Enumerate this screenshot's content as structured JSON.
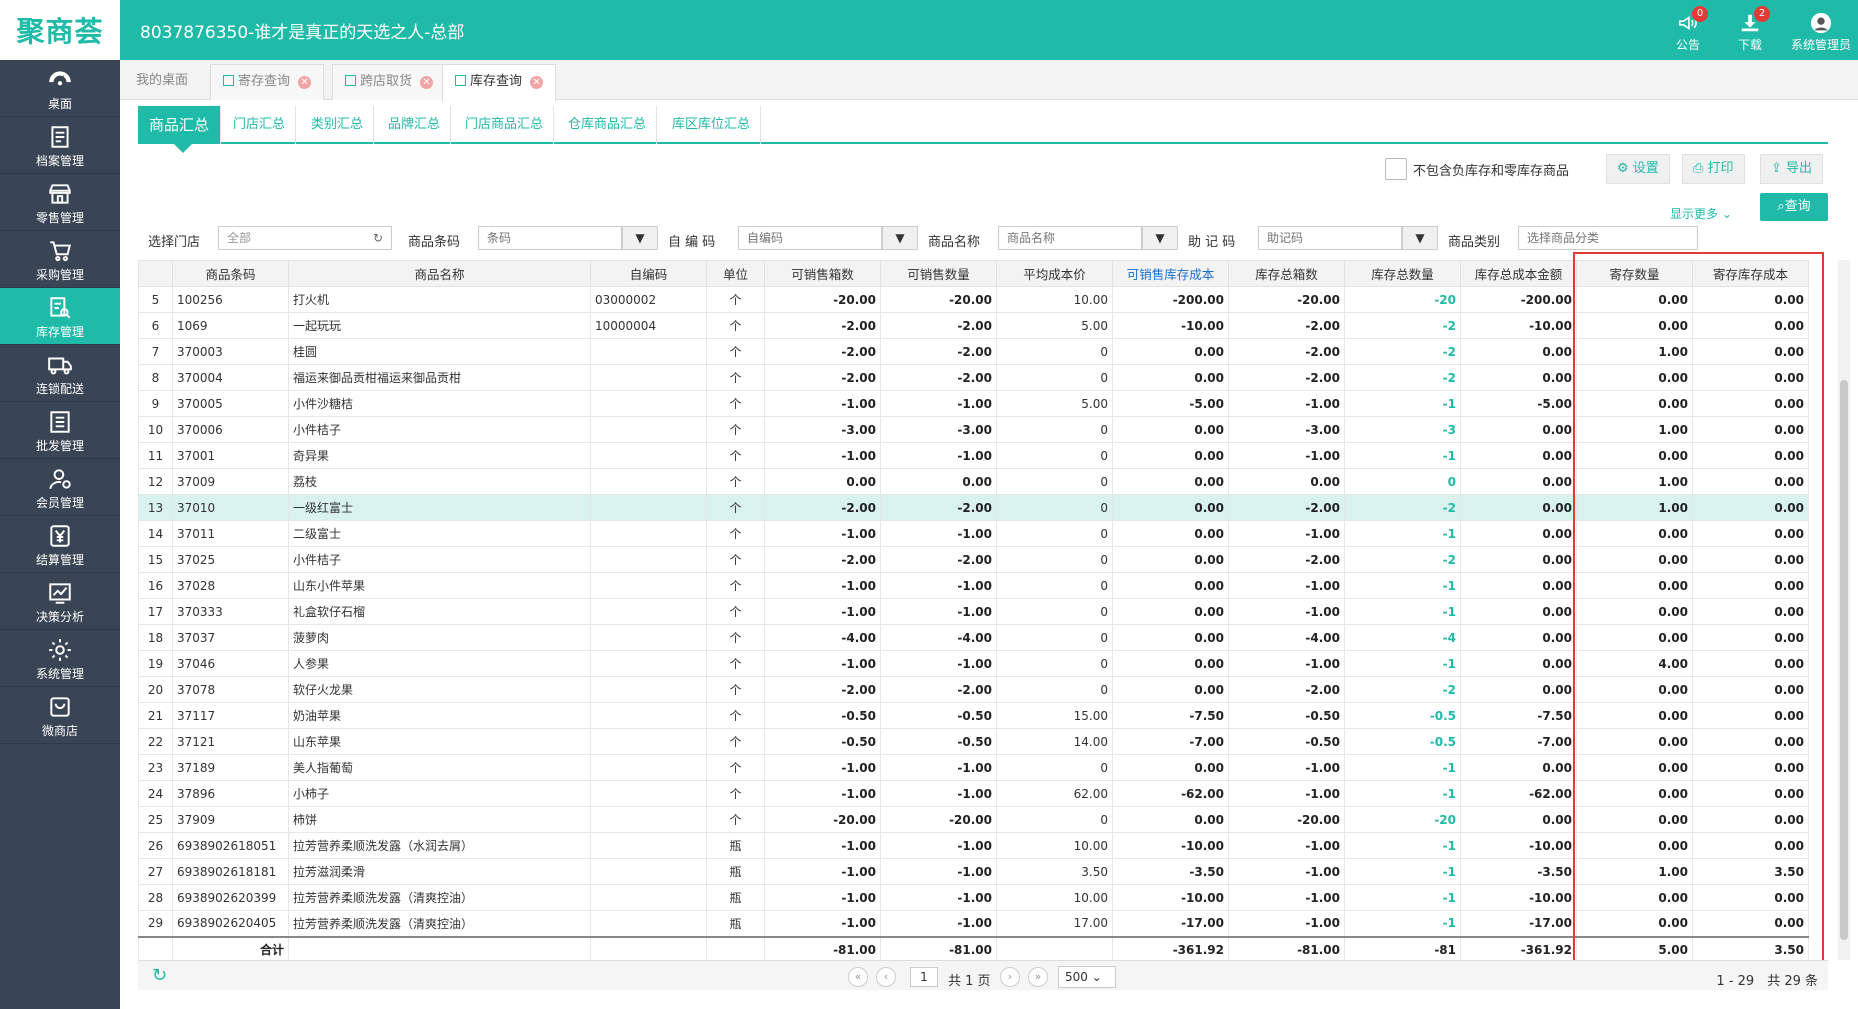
{
  "header": {
    "logo": "聚商荟",
    "title": "8037876350-谁才是真正的天选之人-总部",
    "notice_label": "公告",
    "notice_count": "0",
    "download_label": "下载",
    "download_count": "2",
    "user_label": "系统管理员"
  },
  "sidebar": {
    "items": [
      {
        "label": "桌面",
        "icon": "dashboard-icon"
      },
      {
        "label": "档案管理",
        "icon": "archive-icon"
      },
      {
        "label": "零售管理",
        "icon": "store-icon"
      },
      {
        "label": "采购管理",
        "icon": "cart-icon"
      },
      {
        "label": "库存管理",
        "icon": "inventory-icon"
      },
      {
        "label": "连锁配送",
        "icon": "truck-icon"
      },
      {
        "label": "批发管理",
        "icon": "wholesale-icon"
      },
      {
        "label": "会员管理",
        "icon": "member-icon"
      },
      {
        "label": "结算管理",
        "icon": "yen-icon"
      },
      {
        "label": "决策分析",
        "icon": "chart-icon"
      },
      {
        "label": "系统管理",
        "icon": "gear-icon"
      },
      {
        "label": "微商店",
        "icon": "shop-bag-icon"
      }
    ]
  },
  "tabs": [
    {
      "label": "我的桌面"
    },
    {
      "label": "寄存查询"
    },
    {
      "label": "跨店取货"
    },
    {
      "label": "库存查询"
    }
  ],
  "subnav": [
    "商品汇总",
    "门店汇总",
    "类别汇总",
    "品牌汇总",
    "门店商品汇总",
    "仓库商品汇总",
    "库区库位汇总"
  ],
  "toolbar": {
    "exclude_label": "不包含负库存和零库存商品",
    "settings": "设置",
    "print": "打印",
    "export": "导出",
    "more": "显示更多",
    "query": "查询"
  },
  "filters": {
    "store_label": "选择门店",
    "store_value": "全部",
    "barcode_label": "商品条码",
    "barcode_ph": "条码",
    "selfcode_label": "自 编 码",
    "selfcode_ph": "自编码",
    "name_label": "商品名称",
    "name_ph": "商品名称",
    "memo_label": "助 记 码",
    "memo_ph": "助记码",
    "category_label": "商品类别",
    "category_ph": "选择商品分类"
  },
  "table": {
    "columns": [
      "",
      "商品条码",
      "商品名称",
      "自编码",
      "单位",
      "可销售箱数",
      "可销售数量",
      "平均成本价",
      "可销售库存成本",
      "库存总箱数",
      "库存总数量",
      "库存总成本金额",
      "寄存数量",
      "寄存库存成本"
    ],
    "rows": [
      [
        "5",
        "100256",
        "打火机",
        "03000002",
        "个",
        "-20.00",
        "-20.00",
        "10.00",
        "-200.00",
        "-20.00",
        "-20",
        "-200.00",
        "0.00",
        "0.00"
      ],
      [
        "6",
        "1069",
        "一起玩玩",
        "10000004",
        "个",
        "-2.00",
        "-2.00",
        "5.00",
        "-10.00",
        "-2.00",
        "-2",
        "-10.00",
        "0.00",
        "0.00"
      ],
      [
        "7",
        "370003",
        "桂圆",
        "",
        "个",
        "-2.00",
        "-2.00",
        "0",
        "0.00",
        "-2.00",
        "-2",
        "0.00",
        "1.00",
        "0.00"
      ],
      [
        "8",
        "370004",
        "福运来御品贡柑福运来御品贡柑",
        "",
        "个",
        "-2.00",
        "-2.00",
        "0",
        "0.00",
        "-2.00",
        "-2",
        "0.00",
        "0.00",
        "0.00"
      ],
      [
        "9",
        "370005",
        "小件沙糖桔",
        "",
        "个",
        "-1.00",
        "-1.00",
        "5.00",
        "-5.00",
        "-1.00",
        "-1",
        "-5.00",
        "0.00",
        "0.00"
      ],
      [
        "10",
        "370006",
        "小件桔子",
        "",
        "个",
        "-3.00",
        "-3.00",
        "0",
        "0.00",
        "-3.00",
        "-3",
        "0.00",
        "1.00",
        "0.00"
      ],
      [
        "11",
        "37001",
        "奇异果",
        "",
        "个",
        "-1.00",
        "-1.00",
        "0",
        "0.00",
        "-1.00",
        "-1",
        "0.00",
        "0.00",
        "0.00"
      ],
      [
        "12",
        "37009",
        "荔枝",
        "",
        "个",
        "0.00",
        "0.00",
        "0",
        "0.00",
        "0.00",
        "0",
        "0.00",
        "1.00",
        "0.00"
      ],
      [
        "13",
        "37010",
        "一级红富士",
        "",
        "个",
        "-2.00",
        "-2.00",
        "0",
        "0.00",
        "-2.00",
        "-2",
        "0.00",
        "1.00",
        "0.00"
      ],
      [
        "14",
        "37011",
        "二级富士",
        "",
        "个",
        "-1.00",
        "-1.00",
        "0",
        "0.00",
        "-1.00",
        "-1",
        "0.00",
        "0.00",
        "0.00"
      ],
      [
        "15",
        "37025",
        "小件桔子",
        "",
        "个",
        "-2.00",
        "-2.00",
        "0",
        "0.00",
        "-2.00",
        "-2",
        "0.00",
        "0.00",
        "0.00"
      ],
      [
        "16",
        "37028",
        "山东小件苹果",
        "",
        "个",
        "-1.00",
        "-1.00",
        "0",
        "0.00",
        "-1.00",
        "-1",
        "0.00",
        "0.00",
        "0.00"
      ],
      [
        "17",
        "370333",
        "礼盒软仔石榴",
        "",
        "个",
        "-1.00",
        "-1.00",
        "0",
        "0.00",
        "-1.00",
        "-1",
        "0.00",
        "0.00",
        "0.00"
      ],
      [
        "18",
        "37037",
        "菠萝肉",
        "",
        "个",
        "-4.00",
        "-4.00",
        "0",
        "0.00",
        "-4.00",
        "-4",
        "0.00",
        "0.00",
        "0.00"
      ],
      [
        "19",
        "37046",
        "人参果",
        "",
        "个",
        "-1.00",
        "-1.00",
        "0",
        "0.00",
        "-1.00",
        "-1",
        "0.00",
        "4.00",
        "0.00"
      ],
      [
        "20",
        "37078",
        "软仔火龙果",
        "",
        "个",
        "-2.00",
        "-2.00",
        "0",
        "0.00",
        "-2.00",
        "-2",
        "0.00",
        "0.00",
        "0.00"
      ],
      [
        "21",
        "37117",
        "奶油苹果",
        "",
        "个",
        "-0.50",
        "-0.50",
        "15.00",
        "-7.50",
        "-0.50",
        "-0.5",
        "-7.50",
        "0.00",
        "0.00"
      ],
      [
        "22",
        "37121",
        "山东苹果",
        "",
        "个",
        "-0.50",
        "-0.50",
        "14.00",
        "-7.00",
        "-0.50",
        "-0.5",
        "-7.00",
        "0.00",
        "0.00"
      ],
      [
        "23",
        "37189",
        "美人指葡萄",
        "",
        "个",
        "-1.00",
        "-1.00",
        "0",
        "0.00",
        "-1.00",
        "-1",
        "0.00",
        "0.00",
        "0.00"
      ],
      [
        "24",
        "37896",
        "小柿子",
        "",
        "个",
        "-1.00",
        "-1.00",
        "62.00",
        "-62.00",
        "-1.00",
        "-1",
        "-62.00",
        "0.00",
        "0.00"
      ],
      [
        "25",
        "37909",
        "柿饼",
        "",
        "个",
        "-20.00",
        "-20.00",
        "0",
        "0.00",
        "-20.00",
        "-20",
        "0.00",
        "0.00",
        "0.00"
      ],
      [
        "26",
        "6938902618051",
        "拉芳营养柔顺洗发露（水润去屑）",
        "",
        "瓶",
        "-1.00",
        "-1.00",
        "10.00",
        "-10.00",
        "-1.00",
        "-1",
        "-10.00",
        "0.00",
        "0.00"
      ],
      [
        "27",
        "6938902618181",
        "拉芳滋润柔滑",
        "",
        "瓶",
        "-1.00",
        "-1.00",
        "3.50",
        "-3.50",
        "-1.00",
        "-1",
        "-3.50",
        "1.00",
        "3.50"
      ],
      [
        "28",
        "6938902620399",
        "拉芳营养柔顺洗发露（清爽控油）",
        "",
        "瓶",
        "-1.00",
        "-1.00",
        "10.00",
        "-10.00",
        "-1.00",
        "-1",
        "-10.00",
        "0.00",
        "0.00"
      ],
      [
        "29",
        "6938902620405",
        "拉芳营养柔顺洗发露（清爽控油）",
        "",
        "瓶",
        "-1.00",
        "-1.00",
        "17.00",
        "-17.00",
        "-1.00",
        "-1",
        "-17.00",
        "0.00",
        "0.00"
      ]
    ],
    "summary": [
      "",
      "合计",
      "",
      "",
      "",
      "-81.00",
      "-81.00",
      "",
      "-361.92",
      "-81.00",
      "-81",
      "-361.92",
      "5.00",
      "3.50"
    ]
  },
  "footer": {
    "page": "1",
    "total_pages": "共 1 页",
    "page_size": "500",
    "range": "1 - 29　共 29 条"
  },
  "colors": {
    "accent": "#1fbaa8",
    "sidebar": "#394555",
    "highlight_box": "#e53935"
  }
}
